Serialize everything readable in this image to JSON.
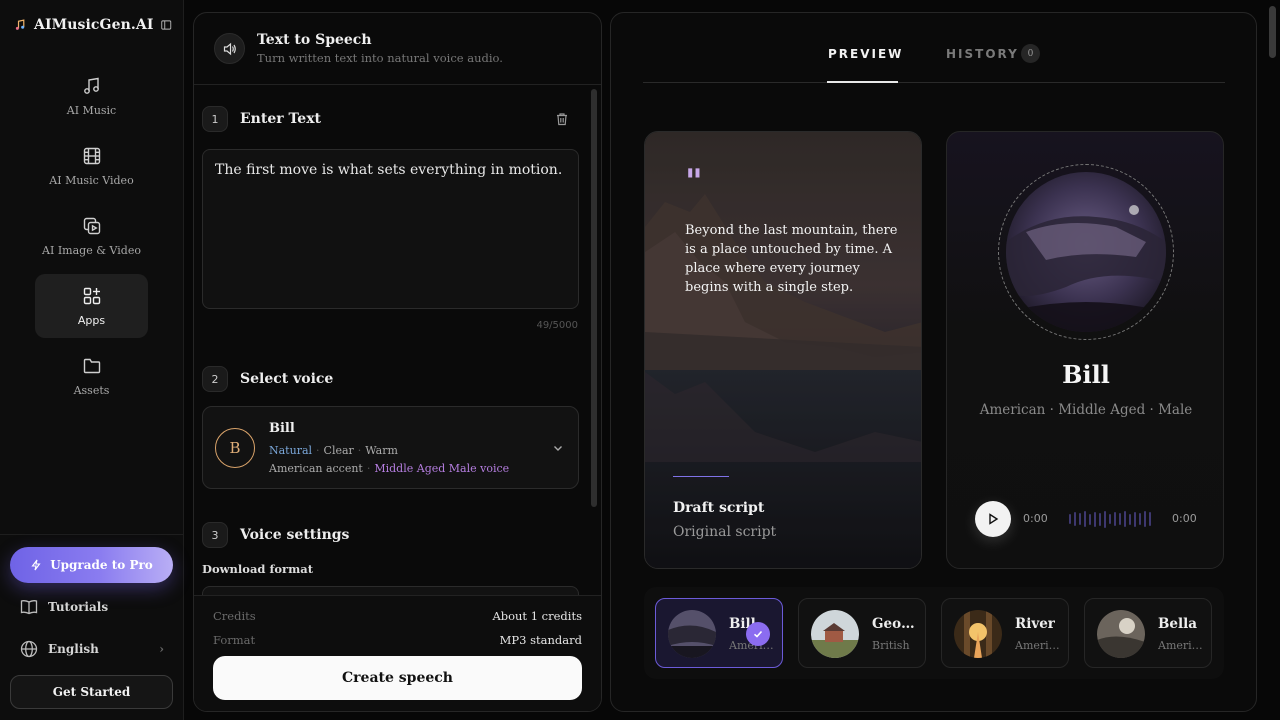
{
  "brand": {
    "name": "AIMusicGen.AI"
  },
  "nav": [
    {
      "label": "AI Music",
      "icon": "music-note-icon"
    },
    {
      "label": "AI Music Video",
      "icon": "film-icon"
    },
    {
      "label": "AI Image & Video",
      "icon": "image-video-icon"
    },
    {
      "label": "Apps",
      "icon": "apps-grid-icon",
      "active": true
    },
    {
      "label": "Assets",
      "icon": "folder-icon"
    }
  ],
  "sidebar_bottom": {
    "upgrade": "Upgrade to Pro",
    "tutorials": "Tutorials",
    "language": "English",
    "get_started": "Get Started"
  },
  "tool": {
    "title": "Text to Speech",
    "subtitle": "Turn written text into natural voice audio."
  },
  "steps": {
    "one": {
      "num": "1",
      "title": "Enter Text"
    },
    "two": {
      "num": "2",
      "title": "Select voice"
    },
    "three": {
      "num": "3",
      "title": "Voice settings"
    }
  },
  "text_input": {
    "value": "The first move is what sets everything in motion.",
    "count": "49/5000"
  },
  "selected_voice": {
    "initial": "B",
    "name": "Bill",
    "tag1": "Natural",
    "tag2": "Clear",
    "tag3": "Warm",
    "accent": "American accent",
    "descriptor": "Middle Aged Male voice"
  },
  "download_format_label": "Download format",
  "footer": {
    "credits_label": "Credits",
    "credits_value": "About 1 credits",
    "format_label": "Format",
    "format_value": "MP3 standard",
    "create_label": "Create speech"
  },
  "tabs": {
    "preview": "PREVIEW",
    "history": "HISTORY",
    "history_count": "0"
  },
  "script_card": {
    "quote": "\"",
    "text": "Beyond the last mountain, there is a place untouched by time. A place where every journey begins with a single step.",
    "draft": "Draft script",
    "original": "Original script"
  },
  "voice_preview": {
    "name": "Bill",
    "meta": "American · Middle Aged · Male",
    "time_start": "0:00",
    "time_end": "0:00"
  },
  "voices": [
    {
      "name": "Bill",
      "accent": "American",
      "selected": true
    },
    {
      "name": "George",
      "accent": "British"
    },
    {
      "name": "River",
      "accent": "American"
    },
    {
      "name": "Bella",
      "accent": "American"
    }
  ],
  "colors": {
    "accent": "#8b6cf0",
    "tag_blue": "#7aa6d8",
    "tag_purple": "#b57ee0",
    "avatar_ring": "#d9a36a"
  }
}
